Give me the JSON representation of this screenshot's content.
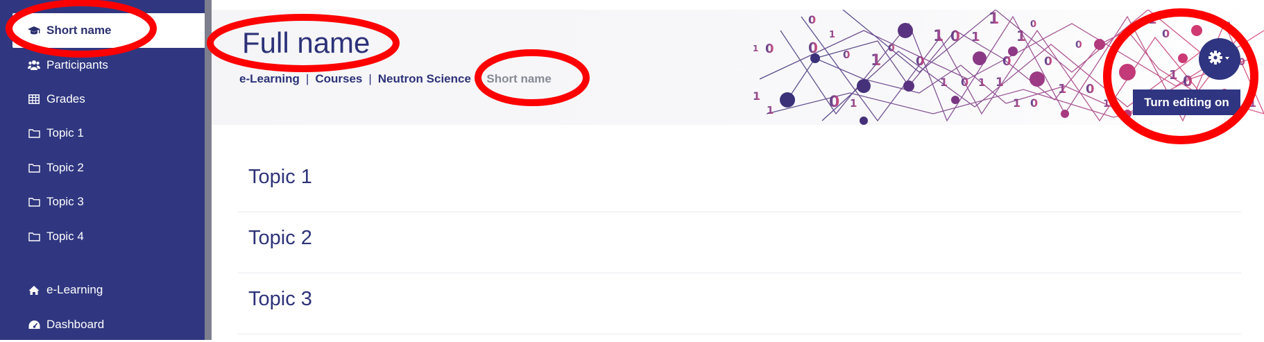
{
  "sidebar": {
    "items": [
      {
        "label": "Short name",
        "icon": "graduation-cap-icon",
        "active": true
      },
      {
        "label": "Participants",
        "icon": "users-icon"
      },
      {
        "label": "Grades",
        "icon": "table-icon"
      },
      {
        "label": "Topic 1",
        "icon": "folder-icon"
      },
      {
        "label": "Topic 2",
        "icon": "folder-icon"
      },
      {
        "label": "Topic 3",
        "icon": "folder-icon"
      },
      {
        "label": "Topic 4",
        "icon": "folder-icon"
      },
      {
        "label": "e-Learning",
        "icon": "home-icon"
      },
      {
        "label": "Dashboard",
        "icon": "dashboard-icon"
      }
    ]
  },
  "header": {
    "title": "Full name",
    "breadcrumb": [
      "e-Learning",
      "Courses",
      "Neutron Science",
      "Short name"
    ],
    "settings_tooltip": "Turn editing on"
  },
  "topics": [
    "Topic 1",
    "Topic 2",
    "Topic 3"
  ],
  "colors": {
    "sidebar": "#303780",
    "accent": "#2f3580",
    "annotation": "#ff0000"
  }
}
